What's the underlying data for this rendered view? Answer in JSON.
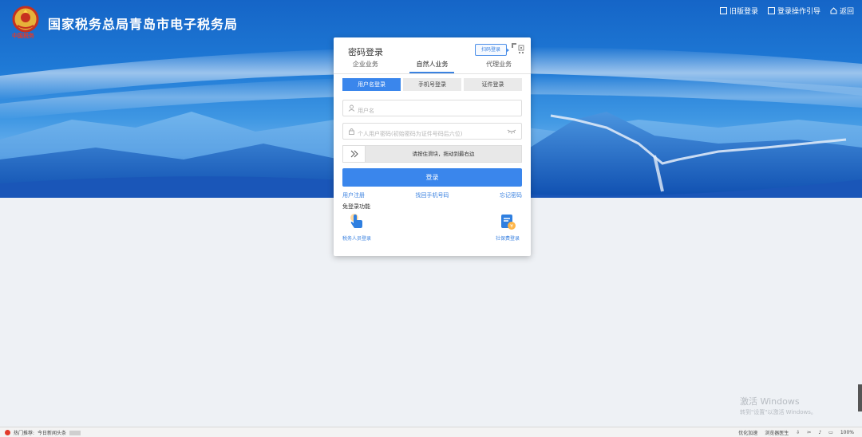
{
  "header": {
    "site_title": "国家税务总局青岛市电子税务局",
    "emblem_caption": "中国税务",
    "links": [
      {
        "label": "旧版登录",
        "icon": "window-icon"
      },
      {
        "label": "登录操作引导",
        "icon": "book-icon"
      },
      {
        "label": "返回",
        "icon": "home-icon"
      }
    ]
  },
  "login": {
    "title": "密码登录",
    "qr_tip": "扫码登录",
    "business_tabs": [
      "企业业务",
      "自然人业务",
      "代理业务"
    ],
    "active_business_tab": 1,
    "mode_tabs": [
      "用户名登录",
      "手机号登录",
      "证件登录"
    ],
    "active_mode_tab": 0,
    "username_placeholder": "用户名",
    "password_placeholder": "个人用户密码(初始密码为证件号码后六位)",
    "slider_text": "请按住滑块，拖动到最右边",
    "slider_handle": "》",
    "submit_label": "登录",
    "links": [
      "用户注册",
      "找回手机号码",
      "忘记密码"
    ],
    "nologin_label": "免登录功能",
    "quick_items": [
      {
        "label": "税务人员登录",
        "icon": "hand-pointer-icon"
      },
      {
        "label": "社保费登录",
        "icon": "document-coin-icon"
      }
    ]
  },
  "watermark": {
    "title": "激活 Windows",
    "subtitle": "转到\"设置\"以激活 Windows。"
  },
  "statusbar": {
    "hot_label": "热门推荐:",
    "hot_item": "今日新闻头条",
    "right_items": [
      "优化加速",
      "浏览器医生",
      "",
      "",
      "",
      "",
      "100%"
    ]
  },
  "colors": {
    "accent": "#3a86ec",
    "banner_top": "#1565c7",
    "page_bg": "#eef1f5"
  }
}
